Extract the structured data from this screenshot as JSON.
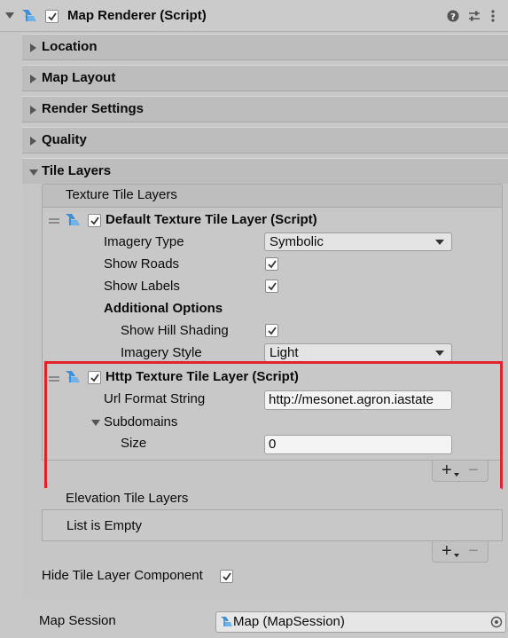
{
  "component": {
    "title": "Map Renderer (Script)",
    "icons": [
      "help-icon",
      "presets-icon",
      "more-icon"
    ]
  },
  "foldouts": {
    "location": "Location",
    "map_layout": "Map Layout",
    "render_settings": "Render Settings",
    "quality": "Quality",
    "tile_layers": "Tile Layers"
  },
  "texture_tile_layers": {
    "header": "Texture Tile Layers",
    "default_layer": {
      "title": "Default Texture Tile Layer (Script)",
      "imagery_type_label": "Imagery Type",
      "imagery_type_value": "Symbolic",
      "show_roads_label": "Show Roads",
      "show_labels_label": "Show Labels",
      "additional_options_label": "Additional Options",
      "show_hill_shading_label": "Show Hill Shading",
      "imagery_style_label": "Imagery Style",
      "imagery_style_value": "Light"
    },
    "http_layer": {
      "title": "Http Texture Tile Layer (Script)",
      "url_label": "Url Format String",
      "url_value": "http://mesonet.agron.iastate",
      "subdomains_label": "Subdomains",
      "size_label": "Size",
      "size_value": "0"
    },
    "plus": "+",
    "minus": "−"
  },
  "elevation_tile_layers": {
    "header": "Elevation Tile Layers",
    "empty_text": "List is Empty",
    "plus": "+",
    "minus": "−"
  },
  "hide_tile_layer_label": "Hide Tile Layer Component",
  "map_session": {
    "label": "Map Session",
    "value": "Map (MapSession)"
  },
  "colors": {
    "highlight_box": "#e0242e",
    "icon_blue": "#3d8fd6"
  }
}
